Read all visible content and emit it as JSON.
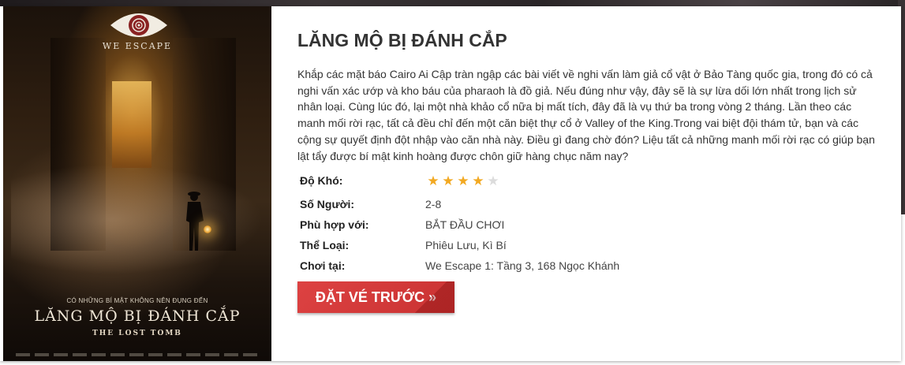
{
  "poster": {
    "brand": "WE ESCAPE",
    "tagline": "CÓ NHỮNG BÍ MẬT KHÔNG NÊN ĐỤNG ĐẾN",
    "title": "LĂNG MỘ BỊ ĐÁNH CẮP",
    "subtitle": "THE LOST TOMB"
  },
  "room": {
    "title": "LĂNG MỘ BỊ ĐÁNH CẮP",
    "description": "Khắp các mặt báo Cairo Ai Cập tràn ngập các bài viết về nghi vấn làm giả cổ vật ở Bảo Tàng quốc gia, trong đó có cả nghi vấn xác ướp và kho báu của pharaoh là đồ giả. Nếu đúng như vậy, đây sẽ là sự lừa dối lớn nhất trong lịch sử nhân loại. Cùng lúc đó, lại một nhà khảo cổ nữa bị mất tích, đây đã là vụ thứ ba trong vòng 2 tháng. Lần theo các manh mối rời rạc, tất cả đều chỉ đến một căn biệt thự cổ ở Valley of the King.Trong vai biệt đội thám tử, bạn và các cộng sự quyết định đột nhập vào căn nhà này. Điều gì đang chờ đón? Liệu tất cả những manh mối rời rạc có giúp bạn lật tẩy được bí mật kinh hoàng được chôn giữ hàng chục năm nay?"
  },
  "details": {
    "difficulty_label": "Độ Khó:",
    "difficulty_rating": 4,
    "difficulty_max": 5,
    "players_label": "Số Người:",
    "players_value": "2-8",
    "suitable_label": "Phù hợp với:",
    "suitable_value": "BẮT ĐẦU CHƠI",
    "genre_label": "Thể Loại:",
    "genre_value": "Phiêu Lưu, Kì Bí",
    "location_label": "Chơi tại:",
    "location_value": "We Escape 1: Tầng 3, 168 Ngọc Khánh"
  },
  "cta": {
    "label": "ĐẶT VÉ TRƯỚC »"
  },
  "colors": {
    "star_filled": "#f2a922",
    "star_empty": "#dcdcdc",
    "cta_background": "#d63b3b",
    "title_text": "#333333"
  }
}
